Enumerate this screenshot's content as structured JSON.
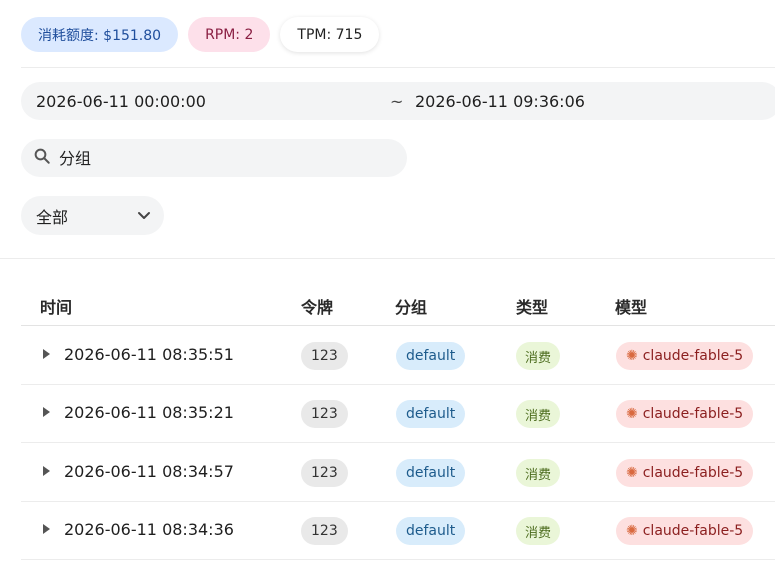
{
  "stats": {
    "quota": "消耗额度: $151.80",
    "rpm": "RPM: 2",
    "tpm": "TPM: 715"
  },
  "date_range": {
    "start": "2026-06-11 00:00:00",
    "separator": "~",
    "end": "2026-06-11 09:36:06"
  },
  "search": {
    "placeholder": "分组"
  },
  "filter_select": {
    "value": "全部"
  },
  "table": {
    "headers": {
      "time": "时间",
      "token": "令牌",
      "group": "分组",
      "type": "类型",
      "model": "模型"
    },
    "rows": [
      {
        "time": "2026-06-11 08:35:51",
        "token": "123",
        "group": "default",
        "type": "消费",
        "model": "claude-fable-5"
      },
      {
        "time": "2026-06-11 08:35:21",
        "token": "123",
        "group": "default",
        "type": "消费",
        "model": "claude-fable-5"
      },
      {
        "time": "2026-06-11 08:34:57",
        "token": "123",
        "group": "default",
        "type": "消费",
        "model": "claude-fable-5"
      },
      {
        "time": "2026-06-11 08:34:36",
        "token": "123",
        "group": "default",
        "type": "消费",
        "model": "claude-fable-5"
      }
    ]
  }
}
